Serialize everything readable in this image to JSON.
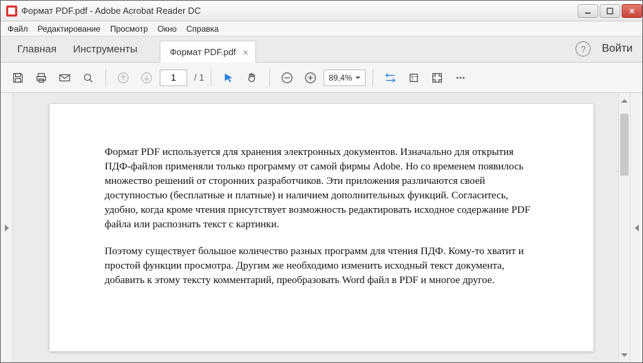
{
  "window": {
    "title": "Формат PDF.pdf - Adobe Acrobat Reader DC"
  },
  "menu": {
    "file": "Файл",
    "edit": "Редактирование",
    "view": "Просмотр",
    "window": "Окно",
    "help": "Справка"
  },
  "tabs": {
    "home": "Главная",
    "tools": "Инструменты",
    "doc_name": "Формат PDF.pdf",
    "signin": "Войти"
  },
  "toolbar": {
    "page_current": "1",
    "page_total": "/ 1",
    "zoom": "89,4%"
  },
  "document": {
    "p1": "Формат PDF используется для хранения электронных документов. Изначально для открытия ПДФ-файлов применяли только программу от самой фирмы Adobe. Но со временем появилось множество решений от сторонних разработчиков. Эти приложения различаются своей доступностью (бесплатные и платные) и наличием дополнительных функций. Согласитесь, удобно, когда кроме чтения присутствует возможность редактировать исходное содержание PDF файла или распознать текст с картинки.",
    "p2": "Поэтому существует большое количество разных программ для чтения ПДФ. Кому-то хватит и простой функции просмотра. Другим же необходимо изменить исходный текст документа, добавить к этому тексту комментарий, преобразовать Word файл в PDF и многое другое."
  }
}
